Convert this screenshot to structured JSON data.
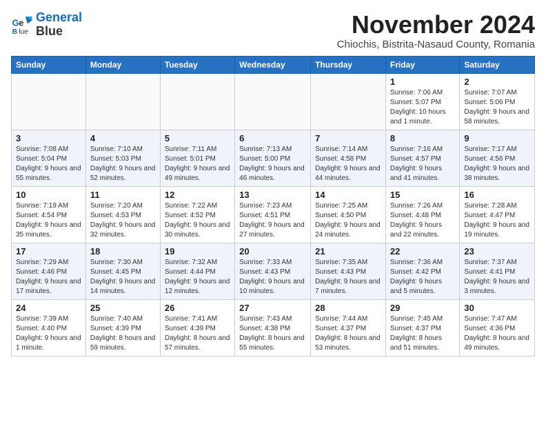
{
  "logo": {
    "line1": "General",
    "line2": "Blue"
  },
  "title": "November 2024",
  "subtitle": "Chiochis, Bistrita-Nasaud County, Romania",
  "days_header": [
    "Sunday",
    "Monday",
    "Tuesday",
    "Wednesday",
    "Thursday",
    "Friday",
    "Saturday"
  ],
  "weeks": [
    [
      {
        "day": "",
        "info": ""
      },
      {
        "day": "",
        "info": ""
      },
      {
        "day": "",
        "info": ""
      },
      {
        "day": "",
        "info": ""
      },
      {
        "day": "",
        "info": ""
      },
      {
        "day": "1",
        "info": "Sunrise: 7:06 AM\nSunset: 5:07 PM\nDaylight: 10 hours and 1 minute."
      },
      {
        "day": "2",
        "info": "Sunrise: 7:07 AM\nSunset: 5:06 PM\nDaylight: 9 hours and 58 minutes."
      }
    ],
    [
      {
        "day": "3",
        "info": "Sunrise: 7:08 AM\nSunset: 5:04 PM\nDaylight: 9 hours and 55 minutes."
      },
      {
        "day": "4",
        "info": "Sunrise: 7:10 AM\nSunset: 5:03 PM\nDaylight: 9 hours and 52 minutes."
      },
      {
        "day": "5",
        "info": "Sunrise: 7:11 AM\nSunset: 5:01 PM\nDaylight: 9 hours and 49 minutes."
      },
      {
        "day": "6",
        "info": "Sunrise: 7:13 AM\nSunset: 5:00 PM\nDaylight: 9 hours and 46 minutes."
      },
      {
        "day": "7",
        "info": "Sunrise: 7:14 AM\nSunset: 4:58 PM\nDaylight: 9 hours and 44 minutes."
      },
      {
        "day": "8",
        "info": "Sunrise: 7:16 AM\nSunset: 4:57 PM\nDaylight: 9 hours and 41 minutes."
      },
      {
        "day": "9",
        "info": "Sunrise: 7:17 AM\nSunset: 4:56 PM\nDaylight: 9 hours and 38 minutes."
      }
    ],
    [
      {
        "day": "10",
        "info": "Sunrise: 7:19 AM\nSunset: 4:54 PM\nDaylight: 9 hours and 35 minutes."
      },
      {
        "day": "11",
        "info": "Sunrise: 7:20 AM\nSunset: 4:53 PM\nDaylight: 9 hours and 32 minutes."
      },
      {
        "day": "12",
        "info": "Sunrise: 7:22 AM\nSunset: 4:52 PM\nDaylight: 9 hours and 30 minutes."
      },
      {
        "day": "13",
        "info": "Sunrise: 7:23 AM\nSunset: 4:51 PM\nDaylight: 9 hours and 27 minutes."
      },
      {
        "day": "14",
        "info": "Sunrise: 7:25 AM\nSunset: 4:50 PM\nDaylight: 9 hours and 24 minutes."
      },
      {
        "day": "15",
        "info": "Sunrise: 7:26 AM\nSunset: 4:48 PM\nDaylight: 9 hours and 22 minutes."
      },
      {
        "day": "16",
        "info": "Sunrise: 7:28 AM\nSunset: 4:47 PM\nDaylight: 9 hours and 19 minutes."
      }
    ],
    [
      {
        "day": "17",
        "info": "Sunrise: 7:29 AM\nSunset: 4:46 PM\nDaylight: 9 hours and 17 minutes."
      },
      {
        "day": "18",
        "info": "Sunrise: 7:30 AM\nSunset: 4:45 PM\nDaylight: 9 hours and 14 minutes."
      },
      {
        "day": "19",
        "info": "Sunrise: 7:32 AM\nSunset: 4:44 PM\nDaylight: 9 hours and 12 minutes."
      },
      {
        "day": "20",
        "info": "Sunrise: 7:33 AM\nSunset: 4:43 PM\nDaylight: 9 hours and 10 minutes."
      },
      {
        "day": "21",
        "info": "Sunrise: 7:35 AM\nSunset: 4:43 PM\nDaylight: 9 hours and 7 minutes."
      },
      {
        "day": "22",
        "info": "Sunrise: 7:36 AM\nSunset: 4:42 PM\nDaylight: 9 hours and 5 minutes."
      },
      {
        "day": "23",
        "info": "Sunrise: 7:37 AM\nSunset: 4:41 PM\nDaylight: 9 hours and 3 minutes."
      }
    ],
    [
      {
        "day": "24",
        "info": "Sunrise: 7:39 AM\nSunset: 4:40 PM\nDaylight: 9 hours and 1 minute."
      },
      {
        "day": "25",
        "info": "Sunrise: 7:40 AM\nSunset: 4:39 PM\nDaylight: 8 hours and 59 minutes."
      },
      {
        "day": "26",
        "info": "Sunrise: 7:41 AM\nSunset: 4:39 PM\nDaylight: 8 hours and 57 minutes."
      },
      {
        "day": "27",
        "info": "Sunrise: 7:43 AM\nSunset: 4:38 PM\nDaylight: 8 hours and 55 minutes."
      },
      {
        "day": "28",
        "info": "Sunrise: 7:44 AM\nSunset: 4:37 PM\nDaylight: 8 hours and 53 minutes."
      },
      {
        "day": "29",
        "info": "Sunrise: 7:45 AM\nSunset: 4:37 PM\nDaylight: 8 hours and 51 minutes."
      },
      {
        "day": "30",
        "info": "Sunrise: 7:47 AM\nSunset: 4:36 PM\nDaylight: 8 hours and 49 minutes."
      }
    ]
  ]
}
